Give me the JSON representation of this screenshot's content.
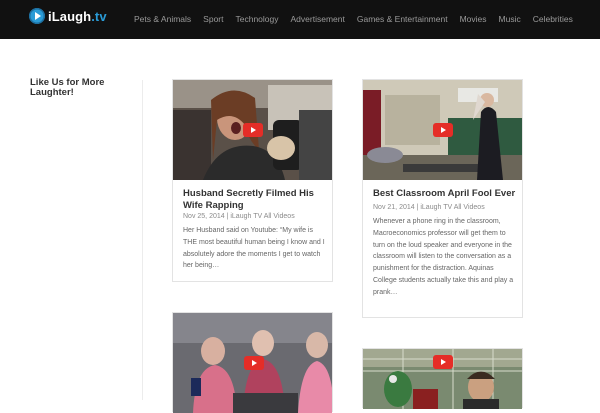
{
  "header": {
    "logo_main": "iLaugh",
    "logo_tld": ".tv",
    "nav": [
      "Pets & Animals",
      "Sport",
      "Technology",
      "Advertisement",
      "Games & Entertainment",
      "Movies",
      "Music",
      "Celebrities"
    ]
  },
  "sidebar": {
    "title": "Like Us for More Laughter!"
  },
  "posts": [
    {
      "title": "Husband Secretly Filmed His Wife Rapping",
      "meta": "Nov 25, 2014 | iLaugh TV All Videos",
      "excerpt": "Her Husband said on Youtube: “My wife is THE most beautiful human being I know and I absolutely adore the moments I get to watch her being…"
    },
    {
      "title": "Best Classroom April Fool Ever",
      "meta": "Nov 21, 2014 | iLaugh TV All Videos",
      "excerpt": "Whenever a phone ring in the classroom, Macroeconomics professor will get them to turn on the loud speaker and everyone in the classroom will listen to the conversation as a punishment for the distraction. Aquinas College students actually take this and play a prank…"
    },
    {
      "title": "",
      "meta": "",
      "excerpt": ""
    },
    {
      "title": "",
      "meta": "",
      "excerpt": ""
    }
  ],
  "colors": {
    "topbar": "#111111",
    "brand_blue": "#2a9bd6",
    "play_red": "#e52d27"
  }
}
